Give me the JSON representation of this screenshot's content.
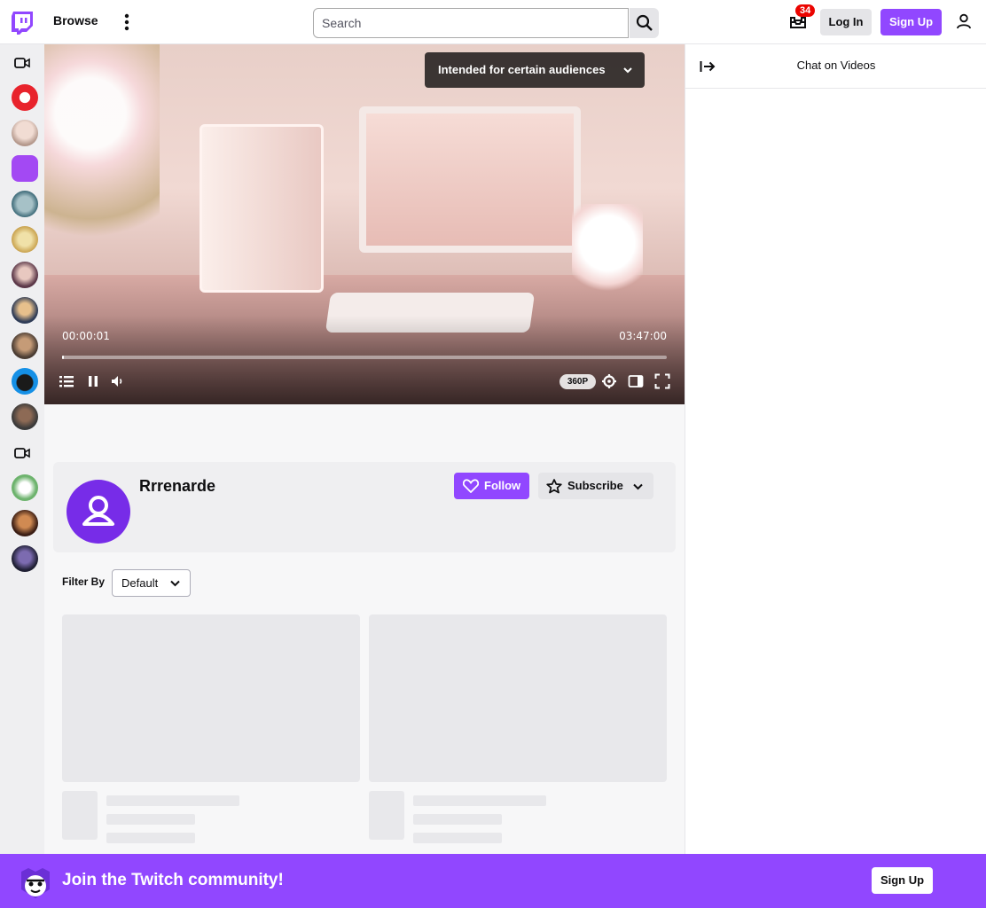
{
  "topbar": {
    "browse_label": "Browse",
    "search_placeholder": "Search",
    "inbox_count": "34",
    "login_label": "Log In",
    "signup_label": "Sign Up"
  },
  "sidenav": {
    "avatar_colors": [
      "#e8232c",
      "#d9c7bf",
      "#a349f3",
      "#5e8d9c",
      "#d9b45c",
      "#6d4b5c",
      "#34415a",
      "#6b5a4c",
      "#1590e6",
      "#4a4a4a",
      "#9fcf7b",
      "#5b2b1e",
      "#2a2a44"
    ]
  },
  "player": {
    "audience_label": "Intended for certain audiences",
    "time_current": "00:00:01",
    "time_total": "03:47:00",
    "progress_fraction": 0.0001,
    "quality": "360P"
  },
  "chat": {
    "title": "Chat on Videos"
  },
  "channel": {
    "name": "Rrrenarde",
    "follow_label": "Follow",
    "subscribe_label": "Subscribe"
  },
  "filter": {
    "label": "Filter By",
    "selected": "Default"
  },
  "banner": {
    "text": "Join the Twitch community!",
    "signup_label": "Sign Up"
  },
  "colors": {
    "brand": "#9147ff",
    "badge": "#eb0400"
  }
}
